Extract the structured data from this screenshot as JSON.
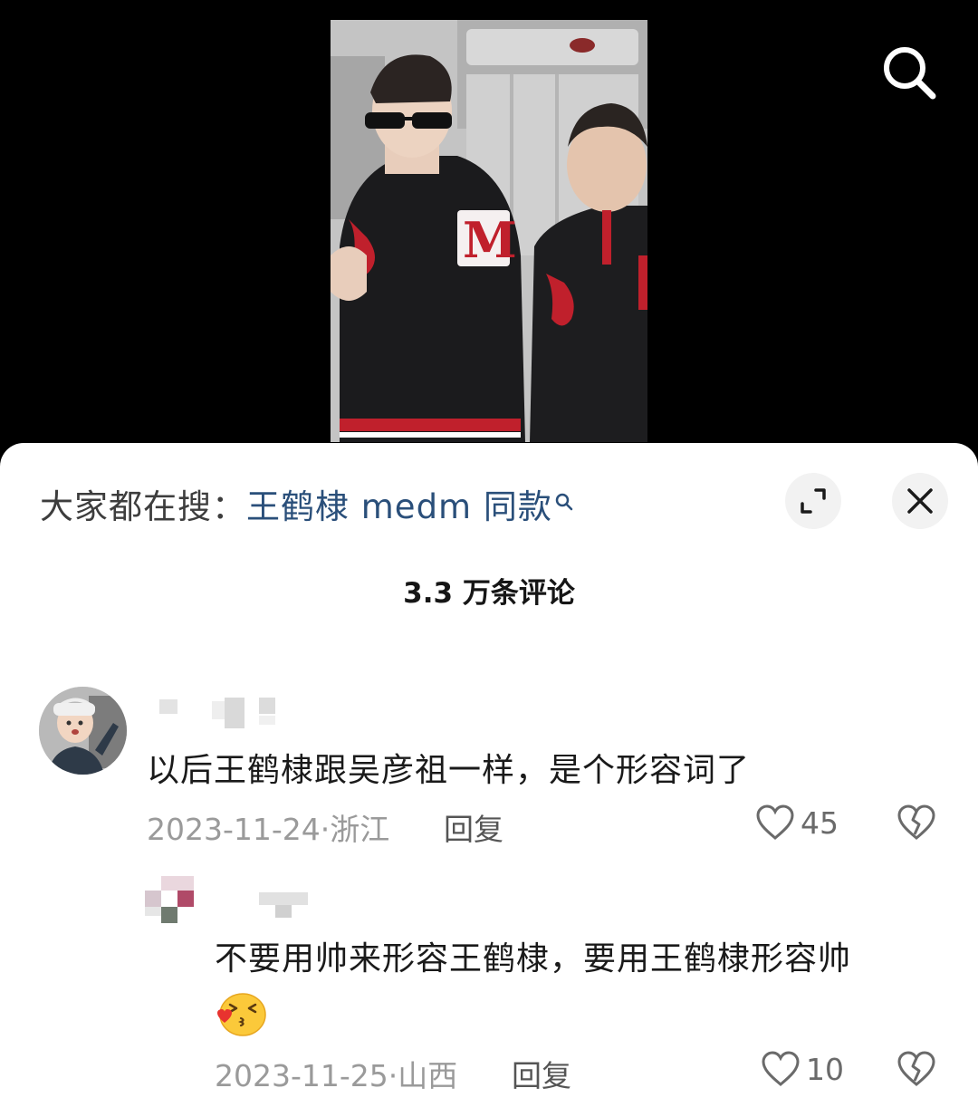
{
  "search_banner": {
    "prefix": "大家都在搜：",
    "keyword": "王鹤棣 medm 同款"
  },
  "comment_count": "3.3 万条评论",
  "comments": [
    {
      "text": "以后王鹤棣跟吴彦祖一样，是个形容词了",
      "date": "2023-11-24",
      "separator": "·",
      "location": "浙江",
      "reply_label": "回复",
      "likes": "45"
    },
    {
      "text_line1": "不要用帅来形容王鹤棣，要用王鹤棣形容帅",
      "emoji": "grinning-face-blowing-kiss",
      "date": "2023-11-25",
      "separator": "·",
      "location": "山西",
      "reply_label": "回复",
      "likes": "10"
    }
  ],
  "icons": {
    "search": "search-icon",
    "expand": "expand-icon",
    "close": "close-icon",
    "like": "heart-outline-icon",
    "dislike": "broken-heart-icon"
  },
  "colors": {
    "keyword": "#2a4f7a",
    "sheet_bg": "#ffffff",
    "meta_text": "#9a9a9a"
  }
}
